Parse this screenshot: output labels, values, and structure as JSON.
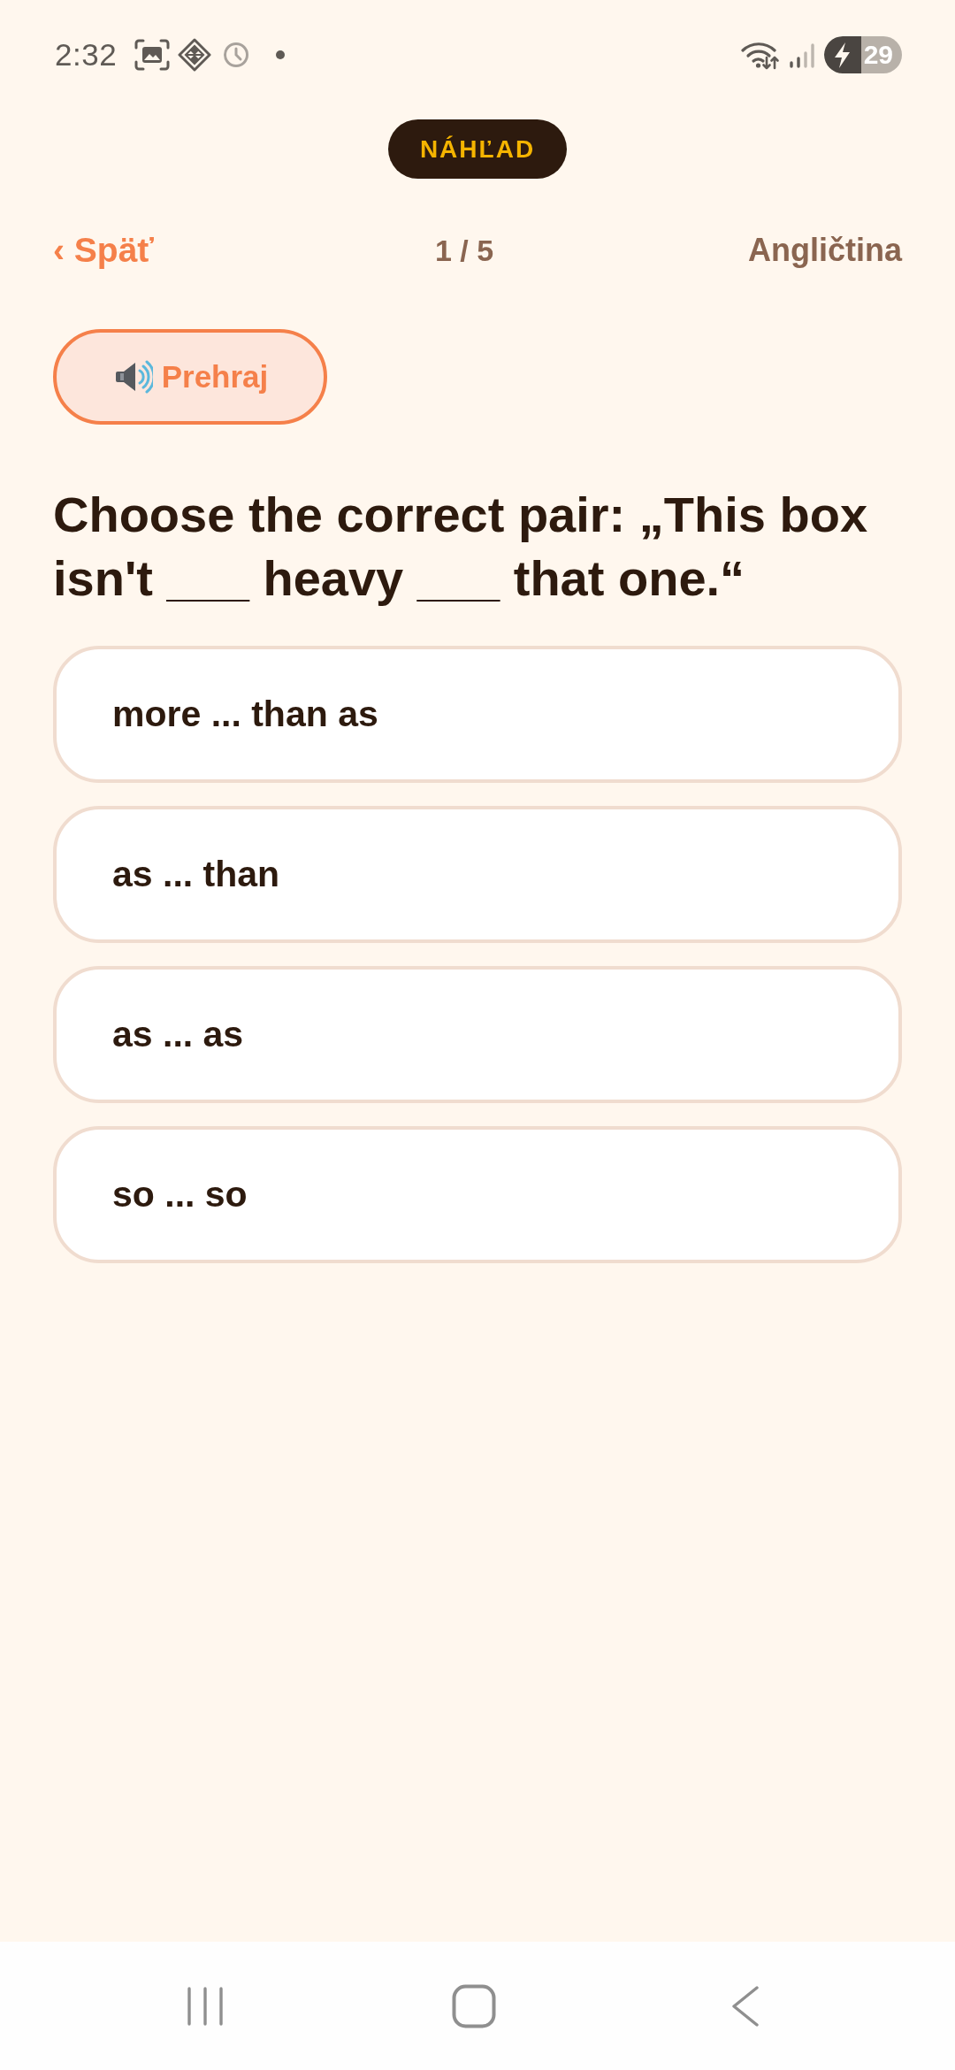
{
  "status_bar": {
    "time": "2:32",
    "battery": "29"
  },
  "preview_badge": {
    "label": "NÁHĽAD"
  },
  "nav": {
    "back": "‹ Späť",
    "progress": "1 / 5",
    "language": "Angličtina"
  },
  "play_button": {
    "label": "Prehraj"
  },
  "question": "Choose the correct pair: „This box isn't ___ heavy ___ that one.“",
  "options": [
    {
      "label": "more ... than as",
      "selected": false
    },
    {
      "label": "as ... than",
      "selected": false
    },
    {
      "label": "as ... as",
      "selected": false
    },
    {
      "label": "so ... so",
      "selected": false
    }
  ]
}
